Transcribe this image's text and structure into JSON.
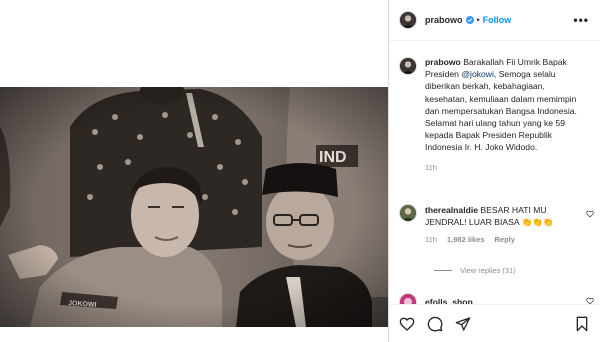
{
  "post": {
    "username": "prabowo",
    "follow_label": "Follow",
    "more_label": "•••",
    "separator": "•"
  },
  "caption": {
    "username": "prabowo",
    "text_before": "Barakallah Fii Umrik Bapak Presiden ",
    "mention": "@jokowi",
    "text_after": ", Semoga selalu diberikan berkah, kebahagiaan, kesehatan, kemuliaan dalam memimpin dan mempersatukan Bangsa Indonesia. Selamat hari ulang tahun yang ke 59 kepada Bapak Presiden Republik Indonesia Ir. H. Joko Widodo.",
    "time": "11h"
  },
  "comments": [
    {
      "username": "therealnaldie",
      "text": "BESAR HATI MU JENDRAL! LUAR BIASA 👏👏👏",
      "time": "11h",
      "likes": "1,982 likes",
      "reply_label": "Reply",
      "view_replies": "View replies (31)"
    },
    {
      "username": "efolls_shop"
    }
  ],
  "photo": {
    "shirt_text": "IND",
    "badge_text": "JOKOWI"
  },
  "icons": [
    "more-icon",
    "verified-icon",
    "heart-icon",
    "comment-icon",
    "share-icon",
    "bookmark-icon"
  ],
  "colors": {
    "accent": "#0095f6",
    "verified": "#3897f0",
    "text": "#262626",
    "secondary": "#8e8e8e"
  }
}
